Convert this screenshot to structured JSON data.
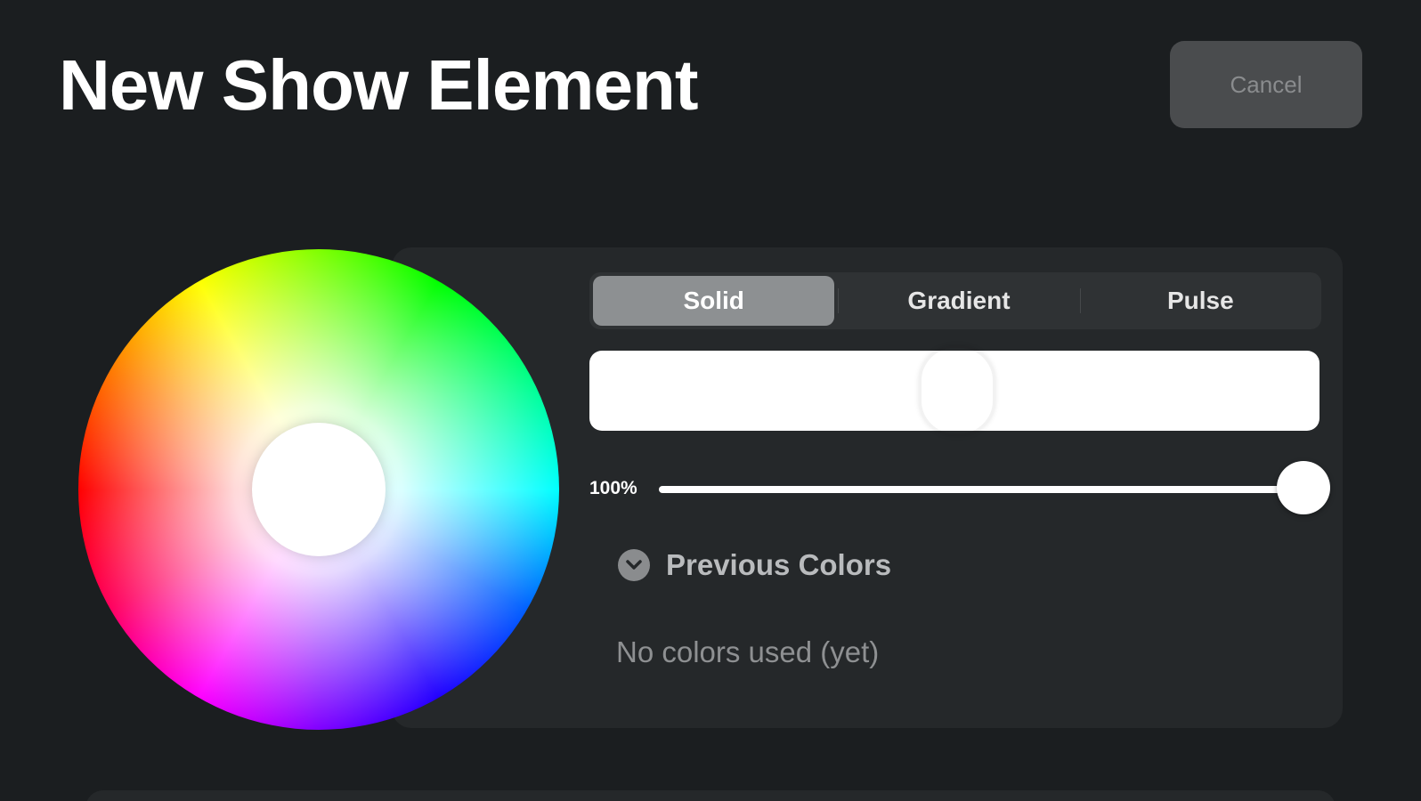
{
  "header": {
    "title": "New Show Element",
    "cancel_label": "Cancel"
  },
  "color_picker": {
    "selected_color": "#ffffff",
    "modes": [
      {
        "label": "Solid",
        "active": true
      },
      {
        "label": "Gradient",
        "active": false
      },
      {
        "label": "Pulse",
        "active": false
      }
    ],
    "brightness": {
      "label": "100%",
      "value": 1.0
    },
    "previous_colors": {
      "label": "Previous Colors",
      "expanded": false,
      "empty_text": "No colors used (yet)"
    }
  },
  "icons": {
    "previous_colors_toggle": "chevron-down-icon"
  },
  "colors": {
    "background": "#1b1e20",
    "panel": "#25282a",
    "segment_active": "#8d9092",
    "cancel_bg": "#4a4c4e"
  }
}
